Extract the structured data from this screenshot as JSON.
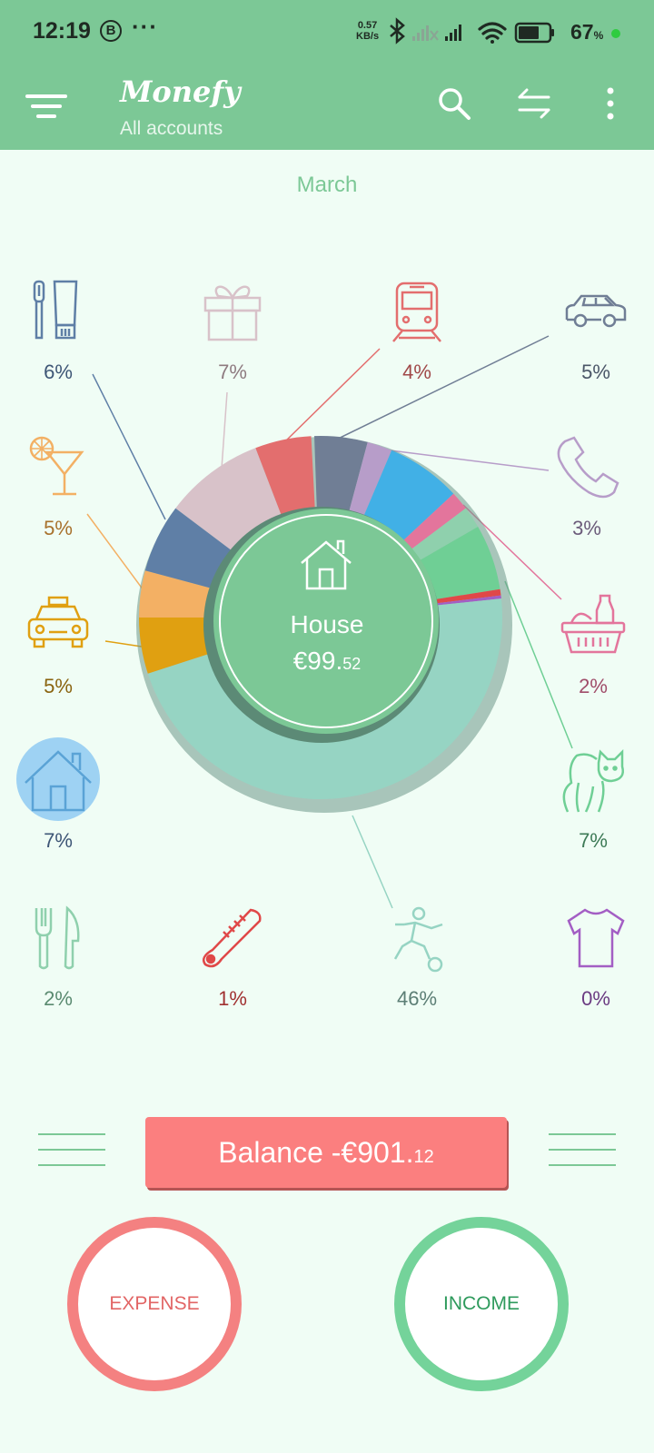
{
  "status_bar": {
    "time": "12:19",
    "notification_badge": "B",
    "more_dots": "···",
    "net_speed_value": "0.57",
    "net_speed_unit": "KB/s",
    "battery_percent": "67",
    "battery_unit": "%"
  },
  "app_bar": {
    "title": "Monefy",
    "subtitle": "All accounts"
  },
  "period": "March",
  "center": {
    "category": "House",
    "amount_main": "€99.",
    "amount_cents": "52"
  },
  "categories": [
    {
      "name": "toiletry",
      "pct": "6%",
      "color": "#5f7fa6"
    },
    {
      "name": "gifts",
      "pct": "7%",
      "color": "#d8c2c9"
    },
    {
      "name": "transport",
      "pct": "4%",
      "color": "#e36e6e"
    },
    {
      "name": "car",
      "pct": "5%",
      "color": "#707e95"
    },
    {
      "name": "communications",
      "pct": "3%",
      "color": "#b79dc9"
    },
    {
      "name": "food",
      "pct": "2%",
      "color": "#e3759c"
    },
    {
      "name": "pets",
      "pct": "7%",
      "color": "#6fcf95"
    },
    {
      "name": "sports",
      "pct": "46%",
      "color": "#96d4c3"
    },
    {
      "name": "clothes",
      "pct": "0%",
      "color": "#a35ec4"
    },
    {
      "name": "health",
      "pct": "1%",
      "color": "#e04848"
    },
    {
      "name": "eating out",
      "pct": "2%",
      "color": "#8fd0ad"
    },
    {
      "name": "house",
      "pct": "7%",
      "color": "#41b0e6"
    },
    {
      "name": "taxi",
      "pct": "5%",
      "color": "#e0a011"
    },
    {
      "name": "entertainment",
      "pct": "5%",
      "color": "#f3b064"
    }
  ],
  "balance": {
    "label": "Balance -€901.",
    "cents": "12"
  },
  "buttons": {
    "expense": "EXPENSE",
    "income": "INCOME"
  }
}
